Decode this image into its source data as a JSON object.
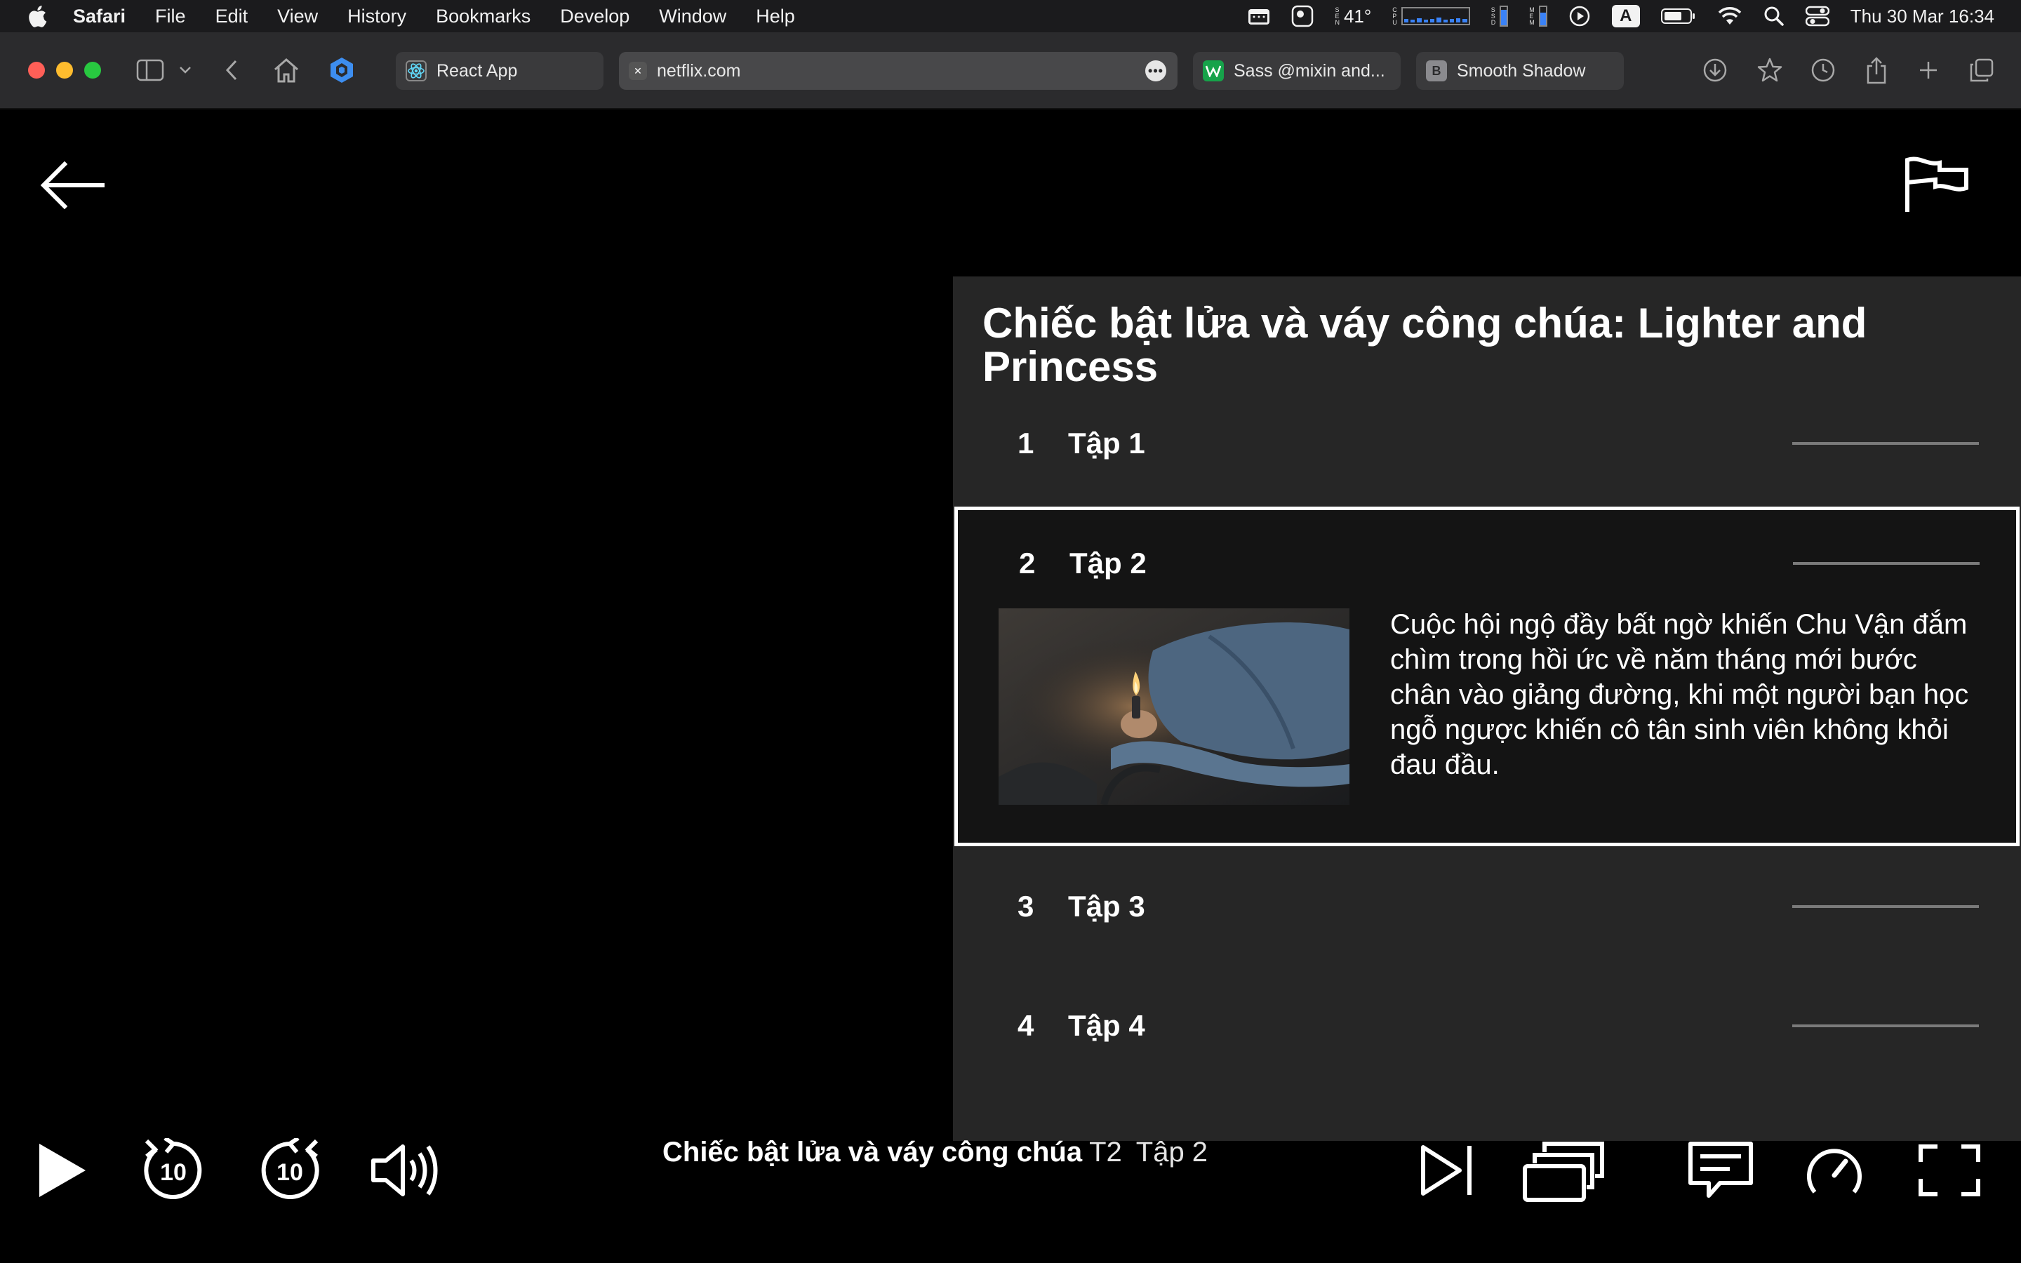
{
  "menubar": {
    "app_name": "Safari",
    "items": [
      "File",
      "Edit",
      "View",
      "History",
      "Bookmarks",
      "Develop",
      "Window",
      "Help"
    ],
    "temperature": "41°",
    "sensor_label": "S\nE\nN",
    "cpu_label": "C\nP\nU",
    "ssd_label": "S\nS\nD",
    "mem_label": "M\nE\nM",
    "input_source": "A",
    "datetime": "Thu 30 Mar  16:34"
  },
  "browser": {
    "tabs": [
      {
        "label": "React App",
        "favicon": "react-icon"
      },
      {
        "label": "netflix.com",
        "favicon": "netflix-icon",
        "active": true
      },
      {
        "label": "Sass @mixin and...",
        "favicon": "w-icon"
      },
      {
        "label": "Smooth Shadow",
        "favicon": "b-icon",
        "favicon_letter": "B"
      }
    ],
    "more_glyph": "•••"
  },
  "player": {
    "panel_title": "Chiếc bật lửa và váy công chúa: Lighter and Princess",
    "episodes": [
      {
        "number": "1",
        "title": "Tập 1"
      },
      {
        "number": "2",
        "title": "Tập 2",
        "selected": true,
        "description": "Cuộc hội ngộ đầy bất ngờ khiến Chu Vận đắm chìm trong hồi ức về năm tháng mới bước chân vào giảng đường, khi một người bạn học ngỗ ngược khiến cô tân sinh viên không khỏi đau đầu."
      },
      {
        "number": "3",
        "title": "Tập 3"
      },
      {
        "number": "4",
        "title": "Tập 4"
      }
    ],
    "now_playing": {
      "show": "Chiếc bật lửa và váy công chúa",
      "season": "T2",
      "episode": "Tập 2"
    },
    "skip_seconds": "10"
  },
  "colors": {
    "panel_bg": "#262626",
    "selected_bg": "#141414",
    "netflix_red": "#e50914"
  }
}
